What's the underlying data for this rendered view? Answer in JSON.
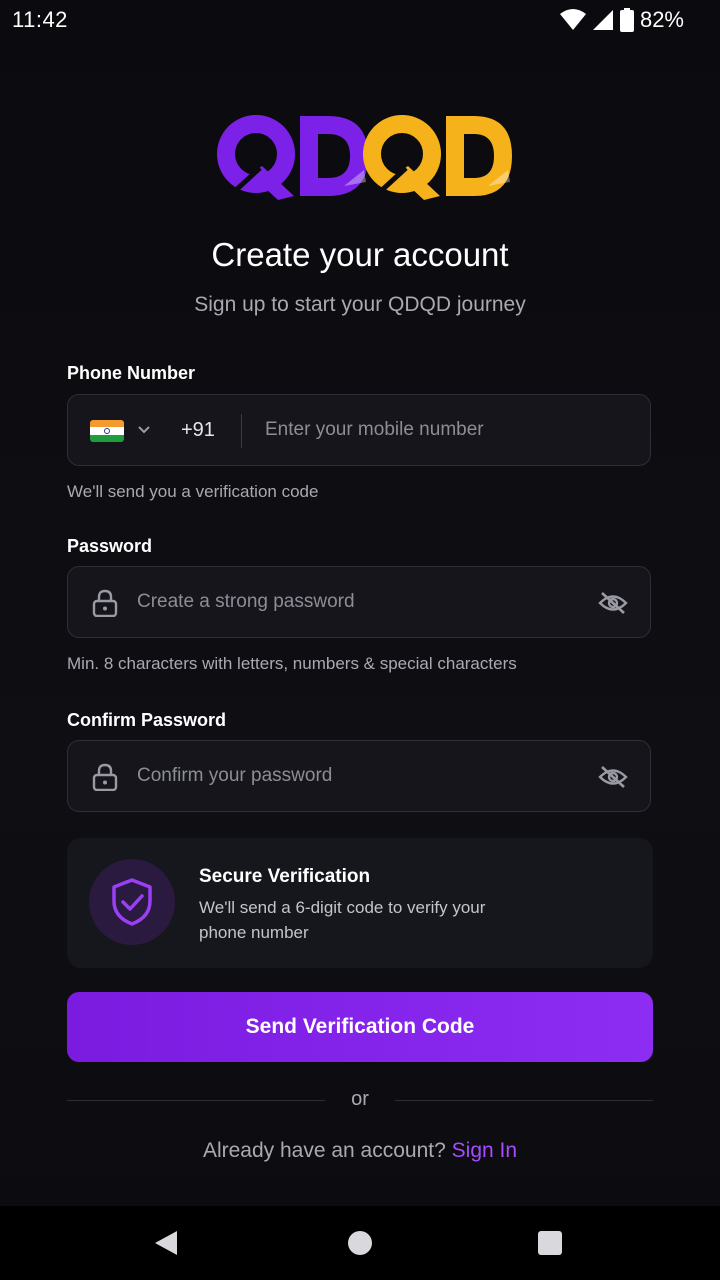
{
  "status_bar": {
    "time": "11:42",
    "battery": "82%",
    "icons": [
      "wifi-icon",
      "signal-icon",
      "battery-icon"
    ]
  },
  "logo": {
    "text": "QDQD",
    "colors": {
      "left": "#7c22e8",
      "right": "#f6b21a"
    }
  },
  "header": {
    "title": "Create your account",
    "subtitle": "Sign up to start your QDQD journey"
  },
  "phone": {
    "label": "Phone Number",
    "country_flag": "india-flag-icon",
    "dial_code": "+91",
    "placeholder": "Enter your mobile number",
    "value": "",
    "hint": "We'll send you a verification code"
  },
  "password": {
    "label": "Password",
    "placeholder": "Create a strong password",
    "value": "",
    "hint": "Min. 8 characters with letters, numbers & special characters"
  },
  "confirm_password": {
    "label": "Confirm Password",
    "placeholder": "Confirm your password",
    "value": ""
  },
  "secure_card": {
    "title": "Secure Verification",
    "text": "We'll send a 6-digit code to verify your phone number",
    "icon": "shield-check-icon"
  },
  "actions": {
    "send_code_label": "Send Verification Code",
    "or_label": "or",
    "signin_prompt": "Already have an account?",
    "signin_link": "Sign In"
  },
  "colors": {
    "accent": "#8d2cf3",
    "link": "#a64bff",
    "background": "#0c0c10",
    "field_bg": "#15151b"
  }
}
